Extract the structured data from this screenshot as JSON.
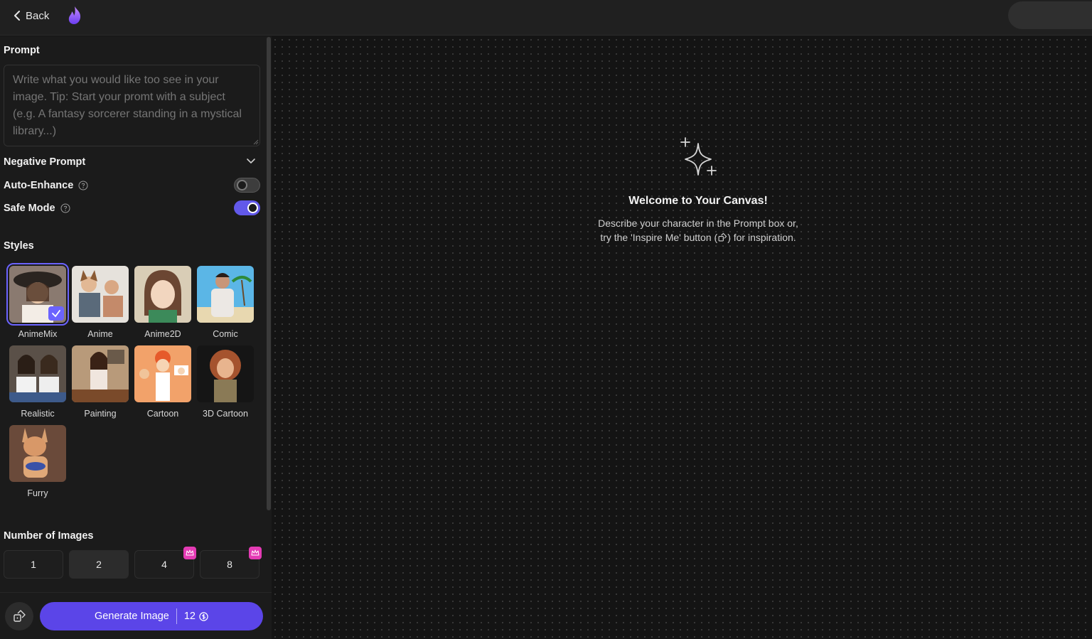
{
  "header": {
    "back_label": "Back"
  },
  "prompt": {
    "title": "Prompt",
    "placeholder": "Write what you would like too see in your image. Tip: Start your promt with a subject (e.g. A fantasy sorcerer standing in a mystical library...)"
  },
  "negative_prompt": {
    "label": "Negative Prompt"
  },
  "auto_enhance": {
    "label": "Auto-Enhance",
    "enabled": false
  },
  "safe_mode": {
    "label": "Safe Mode",
    "enabled": true
  },
  "styles": {
    "title": "Styles",
    "selected": "AnimeMix",
    "items": [
      {
        "label": "AnimeMix"
      },
      {
        "label": "Anime"
      },
      {
        "label": "Anime2D"
      },
      {
        "label": "Comic"
      },
      {
        "label": "Realistic"
      },
      {
        "label": "Painting"
      },
      {
        "label": "Cartoon"
      },
      {
        "label": "3D Cartoon"
      },
      {
        "label": "Furry"
      }
    ]
  },
  "number_of_images": {
    "title": "Number of Images",
    "options": [
      "1",
      "2",
      "4",
      "8"
    ],
    "selected": "2",
    "premium_options": [
      "4",
      "8"
    ]
  },
  "generate": {
    "label": "Generate Image",
    "cost": "12"
  },
  "canvas": {
    "title": "Welcome to Your Canvas!",
    "description_line1": "Describe your character in the Prompt box or,",
    "description_line2_before": "try the 'Inspire Me' button (",
    "description_line2_after": ") for inspiration."
  },
  "colors": {
    "accent": "#5b45e8",
    "premium": "#e43bb4",
    "toggle_on": "#6259ea"
  }
}
